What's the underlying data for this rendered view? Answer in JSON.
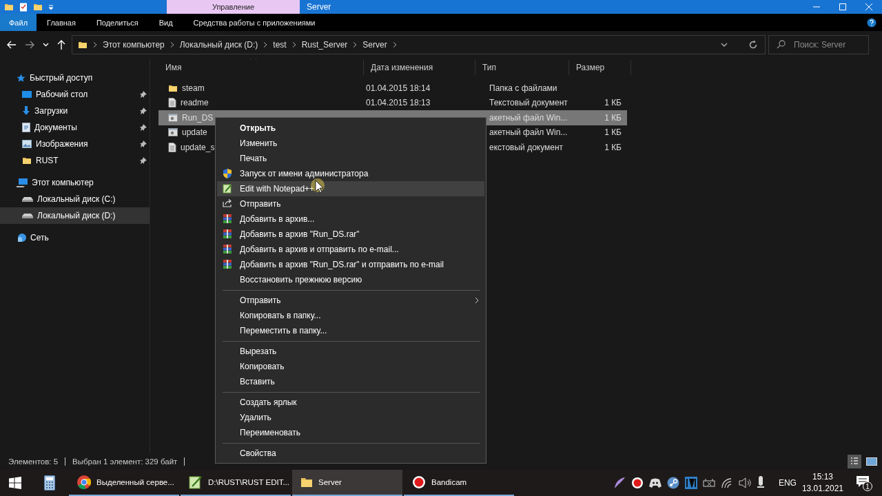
{
  "title_bar": {
    "contextual_tab": "Управление",
    "title": "Server"
  },
  "ribbon_tabs": [
    {
      "label": "Файл",
      "selected": true
    },
    {
      "label": "Главная",
      "selected": false
    },
    {
      "label": "Поделиться",
      "selected": false
    },
    {
      "label": "Вид",
      "selected": false
    },
    {
      "label": "Средства работы с приложениями",
      "selected": false
    }
  ],
  "address_bar": {
    "path": [
      "Этот компьютер",
      "Локальный диск (D:)",
      "test",
      "Rust_Server",
      "Server"
    ]
  },
  "search": {
    "placeholder": "Поиск: Server"
  },
  "sidebar": {
    "items": [
      {
        "label": "Быстрый доступ",
        "kind": "star",
        "selected": false,
        "children": [
          {
            "label": "Рабочий стол",
            "kind": "desktop",
            "pinned": true,
            "selected": false
          },
          {
            "label": "Загрузки",
            "kind": "downloads",
            "pinned": true,
            "selected": false
          },
          {
            "label": "Документы",
            "kind": "documents",
            "pinned": true,
            "selected": false
          },
          {
            "label": "Изображения",
            "kind": "pictures",
            "pinned": true,
            "selected": false
          },
          {
            "label": "RUST",
            "kind": "folder",
            "pinned": true,
            "selected": false
          }
        ]
      },
      {
        "label": "Этот компьютер",
        "kind": "computer",
        "selected": false,
        "children": [
          {
            "label": "Локальный диск (C:)",
            "kind": "drive",
            "pinned": false,
            "selected": false
          },
          {
            "label": "Локальный диск (D:)",
            "kind": "drive",
            "pinned": false,
            "selected": true
          }
        ]
      },
      {
        "label": "Сеть",
        "kind": "network",
        "selected": false
      }
    ]
  },
  "file_list": {
    "columns": [
      "Имя",
      "Дата изменения",
      "Тип",
      "Размер"
    ],
    "rows": [
      {
        "name": "steam",
        "kind": "folder",
        "modified": "01.04.2015 18:14",
        "type": "Папка с файлами",
        "selected": false
      },
      {
        "name": "readme",
        "kind": "text",
        "modified": "01.04.2015 18:13",
        "type": "Текстовый документ",
        "size": "1 КБ",
        "selected": false
      },
      {
        "name": "Run_DS",
        "kind": "batch",
        "type": "акетный файл Win...",
        "size": "1 КБ",
        "selected": true
      },
      {
        "name": "update",
        "kind": "batch",
        "type": "акетный файл Win...",
        "size": "1 КБ",
        "selected": false
      },
      {
        "name": "update_s",
        "kind": "text",
        "type": "екстовый документ",
        "size": "1 КБ",
        "selected": false
      }
    ]
  },
  "context_menu": {
    "items": [
      {
        "label": "Открыть",
        "kind": "command",
        "default": true,
        "selected": false
      },
      {
        "label": "Изменить",
        "kind": "command",
        "default": false,
        "selected": false
      },
      {
        "label": "Печать",
        "kind": "command",
        "default": false,
        "selected": false
      },
      {
        "label": "Запуск от имени администратора",
        "kind": "command",
        "default": false,
        "selected": false
      },
      {
        "label": "Edit with Notepad++",
        "kind": "command",
        "default": false,
        "selected": true
      },
      {
        "label": "Отправить",
        "kind": "command",
        "default": false,
        "selected": false
      },
      {
        "label": "Добавить в архив...",
        "kind": "command",
        "default": false,
        "selected": false
      },
      {
        "label": "Добавить в архив \"Run_DS.rar\"",
        "kind": "command",
        "default": false,
        "selected": false
      },
      {
        "label": "Добавить в архив и отправить по e-mail...",
        "kind": "command",
        "default": false,
        "selected": false
      },
      {
        "label": "Добавить в архив \"Run_DS.rar\" и отправить по e-mail",
        "kind": "command",
        "default": false,
        "selected": false
      },
      {
        "label": "Восстановить прежнюю версию",
        "kind": "command",
        "default": false,
        "selected": false
      },
      {
        "kind": "separator"
      },
      {
        "label": "Отправить",
        "kind": "submenu",
        "default": false,
        "selected": false
      },
      {
        "label": "Копировать в папку...",
        "kind": "command",
        "default": false,
        "selected": false
      },
      {
        "label": "Переместить в папку...",
        "kind": "command",
        "default": false,
        "selected": false
      },
      {
        "kind": "separator"
      },
      {
        "label": "Вырезать",
        "kind": "command",
        "default": false,
        "selected": false
      },
      {
        "label": "Копировать",
        "kind": "command",
        "default": false,
        "selected": false
      },
      {
        "label": "Вставить",
        "kind": "command",
        "default": false,
        "selected": false
      },
      {
        "kind": "separator"
      },
      {
        "label": "Создать ярлык",
        "kind": "command",
        "default": false,
        "selected": false
      },
      {
        "label": "Удалить",
        "kind": "command",
        "default": false,
        "selected": false
      },
      {
        "label": "Переименовать",
        "kind": "command",
        "default": false,
        "selected": false
      },
      {
        "kind": "separator"
      },
      {
        "label": "Свойства",
        "kind": "command",
        "default": false,
        "selected": false
      }
    ]
  },
  "status_bar": {
    "item_count": "Элементов: 5",
    "selection": "Выбран 1 элемент: 329 байт",
    "views": [
      {
        "kind": "details",
        "selected": true
      },
      {
        "kind": "icons",
        "selected": false
      }
    ]
  },
  "taskbar": {
    "apps": [
      {
        "label": "Выделенный серве...",
        "kind": "browser",
        "active": false
      },
      {
        "label": "D:\\RUST\\RUST EDIT...",
        "kind": "notepad",
        "active": false
      },
      {
        "label": "Server",
        "kind": "folder",
        "active": true
      },
      {
        "label": "Bandicam",
        "kind": "recorder",
        "active": false
      }
    ],
    "language": "ENG",
    "time": "15:13",
    "date": "13.01.2021",
    "notification_count": "1"
  }
}
